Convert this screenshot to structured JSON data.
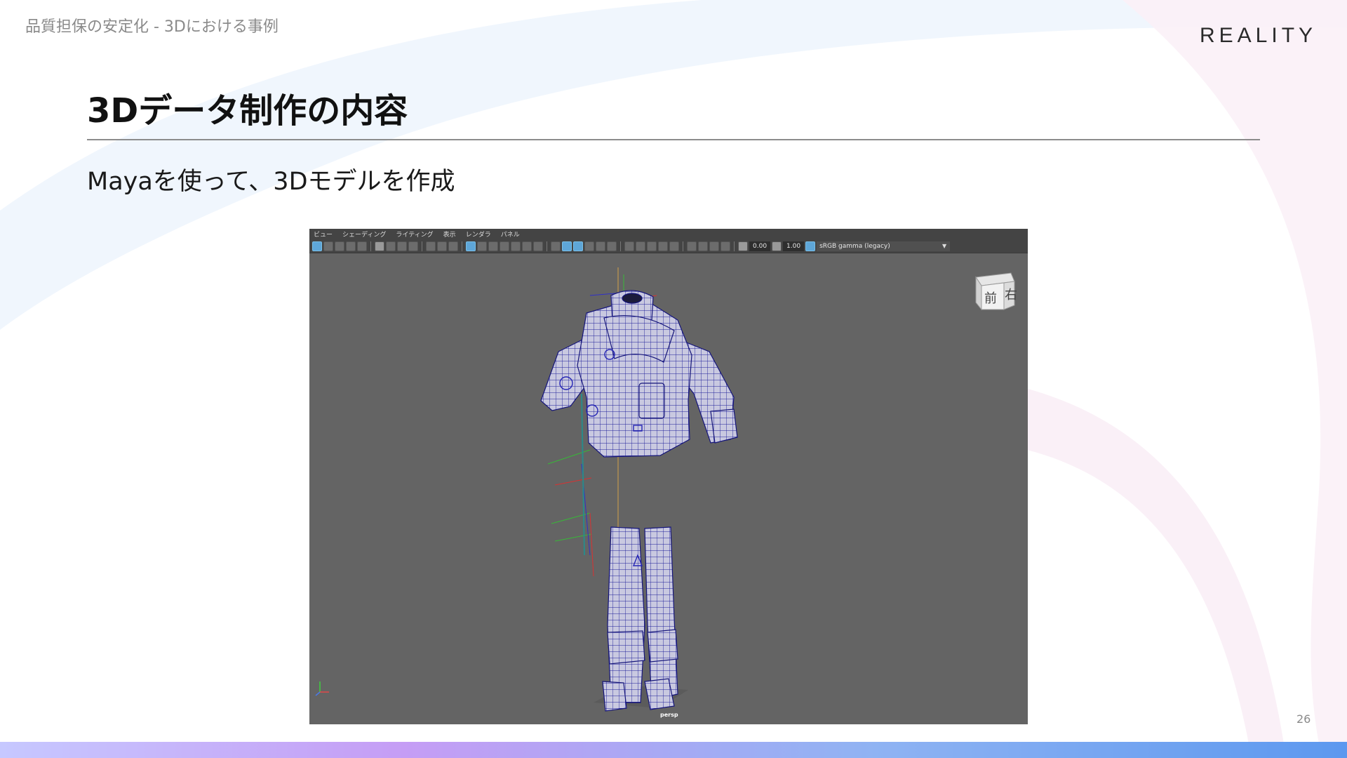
{
  "header": {
    "breadcrumb": "品質担保の安定化 - 3Dにおける事例",
    "logo": "REALITY"
  },
  "slide": {
    "title": "3Dデータ制作の内容",
    "subtitle": "Mayaを使って、3Dモデルを作成",
    "page_number": "26"
  },
  "maya": {
    "menu": [
      "ビュー",
      "シェーディング",
      "ライティング",
      "表示",
      "レンダラ",
      "パネル"
    ],
    "toolbar": {
      "exposure": "0.00",
      "gamma": "1.00",
      "color_space": "sRGB gamma (legacy)"
    },
    "viewcube": {
      "front": "前",
      "right": "右"
    },
    "camera": "persp"
  },
  "colors": {
    "accent_gradient": [
      "#c6c8ff",
      "#c59df5",
      "#8fb3f3",
      "#5c98ef"
    ],
    "viewport_bg": "#646464",
    "wireframe": "#1e1e9a"
  },
  "icons": [
    "select-icon",
    "lasso-icon",
    "camera-icon",
    "bookmark-icon",
    "grid-icon",
    "wireframe-icon",
    "smooth-shade-icon",
    "texture-icon",
    "light-icon",
    "isolate-icon",
    "xray-icon",
    "exposure-icon",
    "gamma-icon",
    "color-space-icon",
    "viewcube-icon",
    "axis-gizmo-icon"
  ]
}
